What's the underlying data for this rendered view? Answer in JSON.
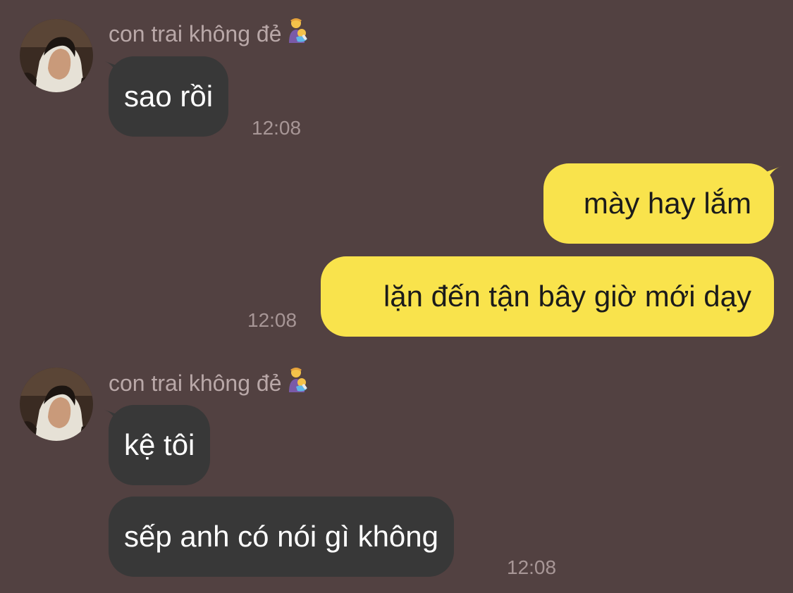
{
  "colors": {
    "background": "#524141",
    "incoming_bubble": "#383838",
    "outgoing_bubble": "#f9e34c",
    "incoming_text": "#ffffff",
    "outgoing_text": "#1b1b1b",
    "sender_name": "#b9a8a8",
    "timestamp": "#a79696"
  },
  "groups": [
    {
      "sender_name": "con trai không đẻ",
      "sender_emoji_icon": "man-feeding-baby-icon",
      "messages": [
        {
          "text": "sao rồi",
          "time": "12:08"
        }
      ]
    },
    {
      "outgoing": true,
      "messages": [
        {
          "text": "mày hay lắm"
        },
        {
          "text": "lặn đến tận bây giờ mới dạy",
          "time": "12:08"
        }
      ]
    },
    {
      "sender_name": "con trai không đẻ",
      "sender_emoji_icon": "man-feeding-baby-icon",
      "messages": [
        {
          "text": "kệ tôi"
        },
        {
          "text": "sếp anh có nói gì không",
          "time": "12:08"
        }
      ]
    }
  ]
}
